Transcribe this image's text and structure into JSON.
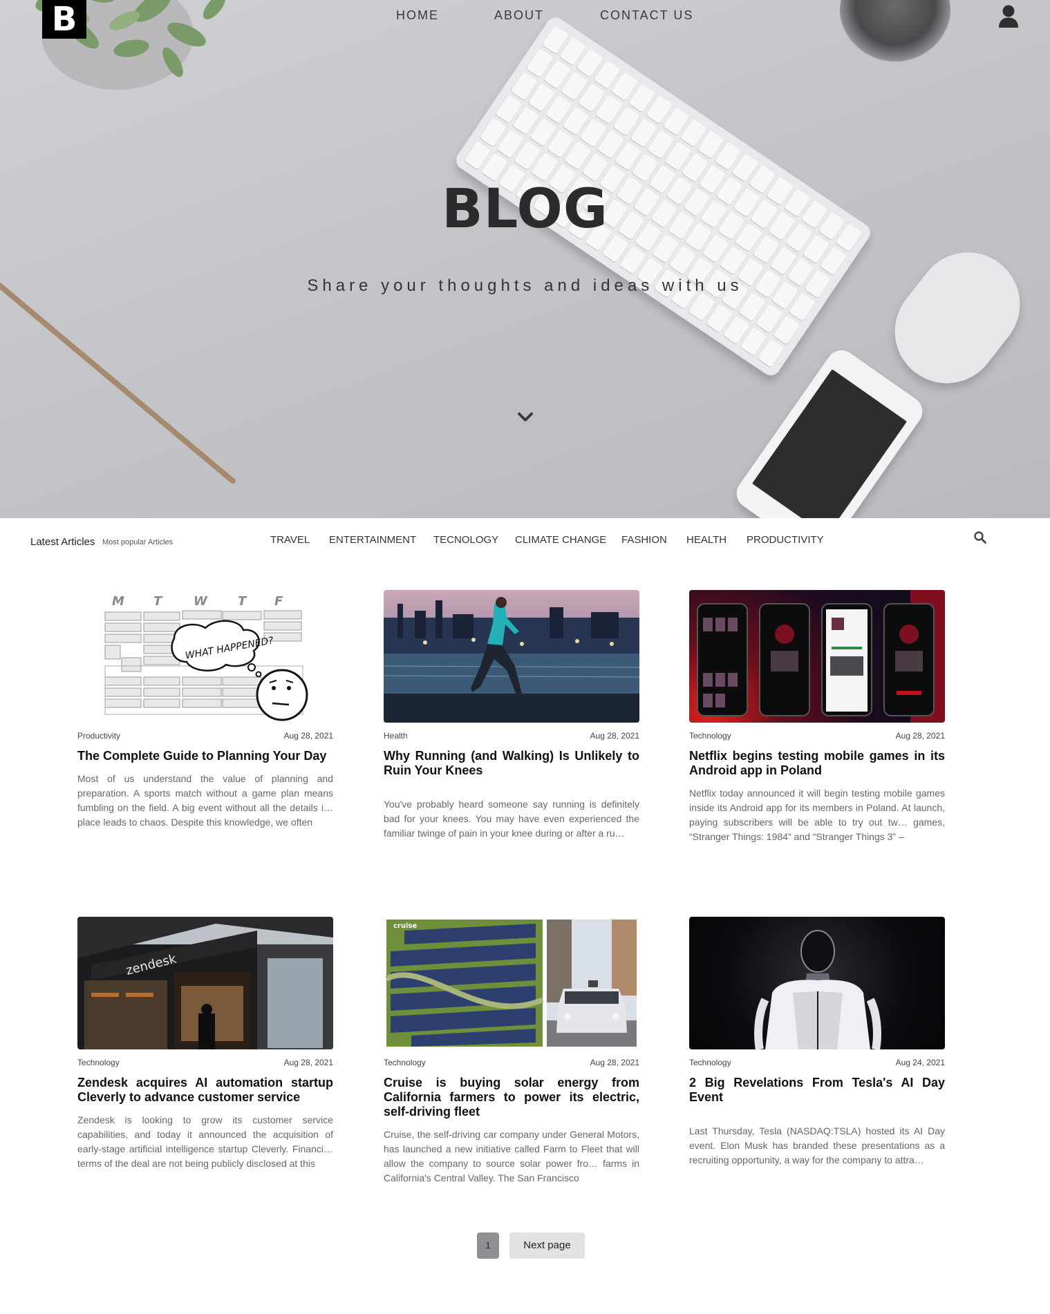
{
  "brand": {
    "logo_letter": "B"
  },
  "nav": {
    "items": [
      "HOME",
      "ABOUT",
      "CONTACT US"
    ]
  },
  "hero": {
    "title": "BLOG",
    "subtitle": "Share your thoughts and ideas with us"
  },
  "filter": {
    "latest": "Latest Articles",
    "popular": "Most popular Articles",
    "categories": [
      "TRAVEL",
      "ENTERTAINMENT",
      "TECNOLOGY",
      "CLIMATE CHANGE",
      "FASHION",
      "HEALTH",
      "PRODUCTIVITY"
    ]
  },
  "articles": [
    {
      "category": "Productivity",
      "date": "Aug 28, 2021",
      "title": "The Complete Guide to Planning Your Day",
      "excerpt": "Most of us understand the value of planning and preparation. A sports match without a game plan means fumbling on the field. A big event without all the details i… place leads to chaos. Despite this knowledge, we often",
      "image_text": [
        "M",
        "T",
        "W",
        "T",
        "F",
        "WHAT HAPPENED?"
      ]
    },
    {
      "category": "Health",
      "date": "Aug 28, 2021",
      "title": "Why Running (and Walking) Is Unlikely to Ruin Your Knees",
      "excerpt": "You've probably heard someone say running is definitely bad for your knees. You may have even experienced the familiar twinge of pain in your knee during or after a ru…"
    },
    {
      "category": "Technology",
      "date": "Aug 28, 2021",
      "title": "Netflix begins testing mobile games in its Android app in Poland",
      "excerpt": "Netflix today announced it will begin testing mobile games inside its Android app for its members in Poland. At launch, paying subscribers will be able to try out tw… games, “Stranger Things: 1984” and “Stranger Things 3” –"
    },
    {
      "category": "Technology",
      "date": "Aug 28, 2021",
      "title": "Zendesk acquires AI automation startup Cleverly to advance customer service",
      "excerpt": "Zendesk is looking to grow its customer service capabilities, and today it announced the acquisition of early-stage artificial intelligence startup Cleverly. Financi… terms of the deal are not being publicly disclosed at this",
      "image_text": [
        "zendesk"
      ]
    },
    {
      "category": "Technology",
      "date": "Aug 28, 2021",
      "title": "Cruise is buying solar energy from California farmers to power its electric, self-driving fleet",
      "excerpt": "Cruise, the self-driving car company under General Motors, has launched a new initiative called Farm to Fleet that will allow the company to source solar power fro… farms in California's Central Valley. The San Francisco",
      "image_text": [
        "cruise"
      ]
    },
    {
      "category": "Technology",
      "date": "Aug 24, 2021",
      "title": "2 Big Revelations From Tesla's AI Day Event",
      "excerpt": "Last Thursday, Tesla (NASDAQ:TSLA) hosted its AI Day event. Elon Musk has branded these presentations as a recruiting opportunity, a way for the company to attra…"
    }
  ],
  "pagination": {
    "current": "1",
    "next_label": "Next page"
  }
}
